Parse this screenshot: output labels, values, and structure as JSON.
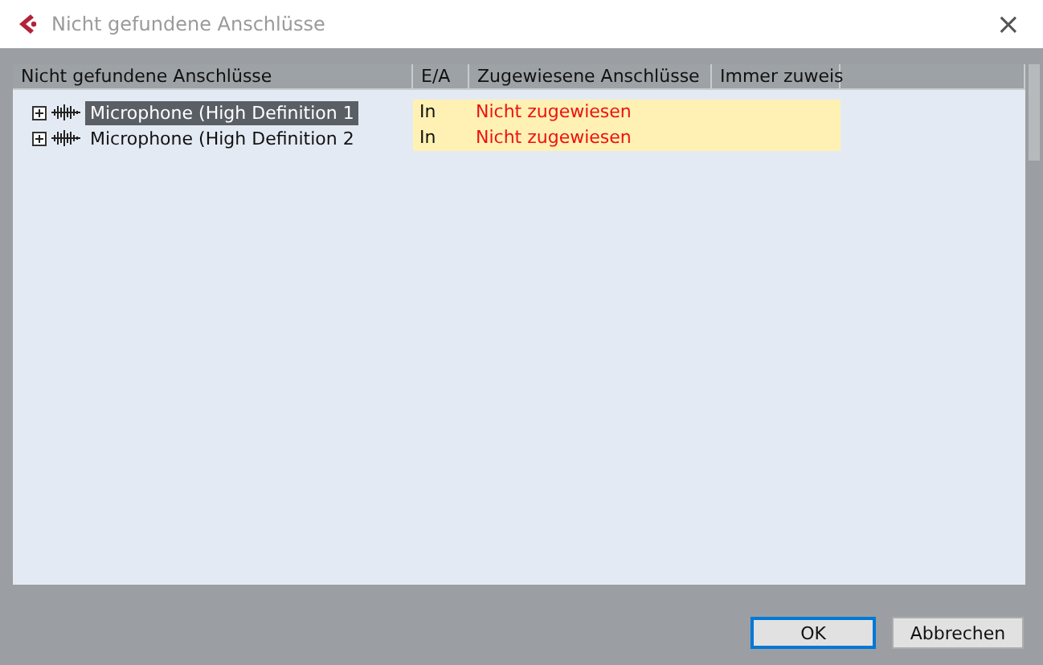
{
  "window": {
    "title": "Nicht gefundene Anschlüsse",
    "close": "×"
  },
  "table": {
    "columns": [
      "Nicht gefundene Anschlüsse",
      "E/A",
      "Zugewiesene Anschlüsse",
      "Immer zuweis"
    ],
    "rows": [
      {
        "name": "Microphone (High Definition  1",
        "io": "In",
        "assigned": "Nicht zugewiesen",
        "expanded": false,
        "selected": true
      },
      {
        "name": "Microphone (High Definition  2",
        "io": "In",
        "assigned": "Nicht zugewiesen",
        "expanded": false,
        "selected": false
      }
    ]
  },
  "buttons": [
    {
      "label": "OK",
      "default": true
    },
    {
      "label": "Abbrechen",
      "default": false
    }
  ]
}
